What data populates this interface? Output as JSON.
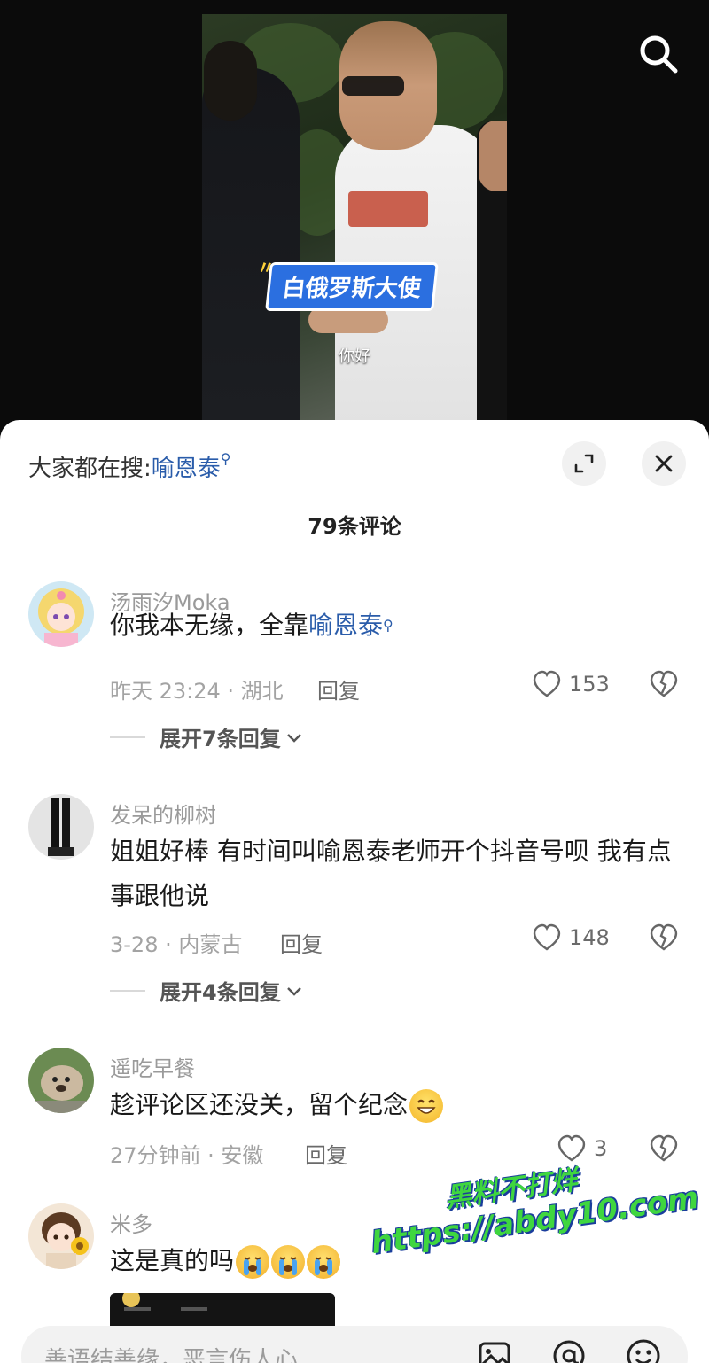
{
  "video": {
    "caption_tag": "白俄罗斯大使",
    "subtitle": "你好"
  },
  "sheet": {
    "hot_search_prefix": "大家都在搜:",
    "hot_search_keyword": "喻恩泰",
    "comment_count": "79条评论"
  },
  "comments": [
    {
      "username": "汤雨汐Moka",
      "text_before": "你我本无缘，全靠",
      "text_keyword": "喻恩泰",
      "meta": "昨天 23:24 · 湖北",
      "reply_label": "回复",
      "likes": "153",
      "expand_label": "展开7条回复"
    },
    {
      "username": "发呆的柳树",
      "text": "姐姐好棒 有时间叫喻恩泰老师开个抖音号呗 我有点事跟他说",
      "meta": "3-28 · 内蒙古",
      "reply_label": "回复",
      "likes": "148",
      "expand_label": "展开4条回复"
    },
    {
      "username": "遥吃早餐",
      "text": "趁评论区还没关，留个纪念",
      "meta": "27分钟前 · 安徽",
      "reply_label": "回复",
      "likes": "3"
    },
    {
      "username": "米多",
      "text": "这是真的吗"
    }
  ],
  "watermark": {
    "line1": "黑料不打烊",
    "line2": "https://abdy10.com"
  },
  "input": {
    "placeholder": "善语结善缘，恶言伤人心"
  },
  "colors": {
    "keyword": "#2a5caa",
    "watermark_green": "#3fd63f",
    "caption_blue": "#2b6fe0"
  },
  "icons": [
    "search-icon",
    "expand-icon",
    "close-icon",
    "heart-icon",
    "dislike-icon",
    "chevron-down-icon",
    "image-icon",
    "at-icon",
    "emoji-icon"
  ]
}
